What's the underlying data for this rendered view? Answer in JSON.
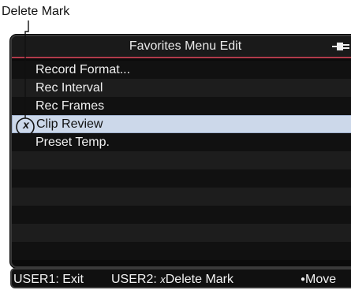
{
  "callout": {
    "label": "Delete Mark"
  },
  "screen": {
    "title": "Favorites Menu Edit",
    "title_icon": "battery-plug-icon",
    "accent_color": "#b03a4a",
    "selected_color": "#ccd8ea",
    "items": [
      {
        "label": "Record Format...",
        "selected": false,
        "delete_mark": false
      },
      {
        "label": "Rec Interval",
        "selected": false,
        "delete_mark": false
      },
      {
        "label": "Rec Frames",
        "selected": false,
        "delete_mark": false
      },
      {
        "label": "Clip Review",
        "selected": true,
        "delete_mark": true
      },
      {
        "label": "Preset Temp.",
        "selected": false,
        "delete_mark": false
      }
    ],
    "delete_mark_symbol": "x"
  },
  "status_bar": {
    "user1": "USER1: Exit",
    "user2_prefix": "USER2: ",
    "user2_mark": "x",
    "user2_text": "Delete Mark",
    "move_dot": "●",
    "move_text": "Move"
  }
}
